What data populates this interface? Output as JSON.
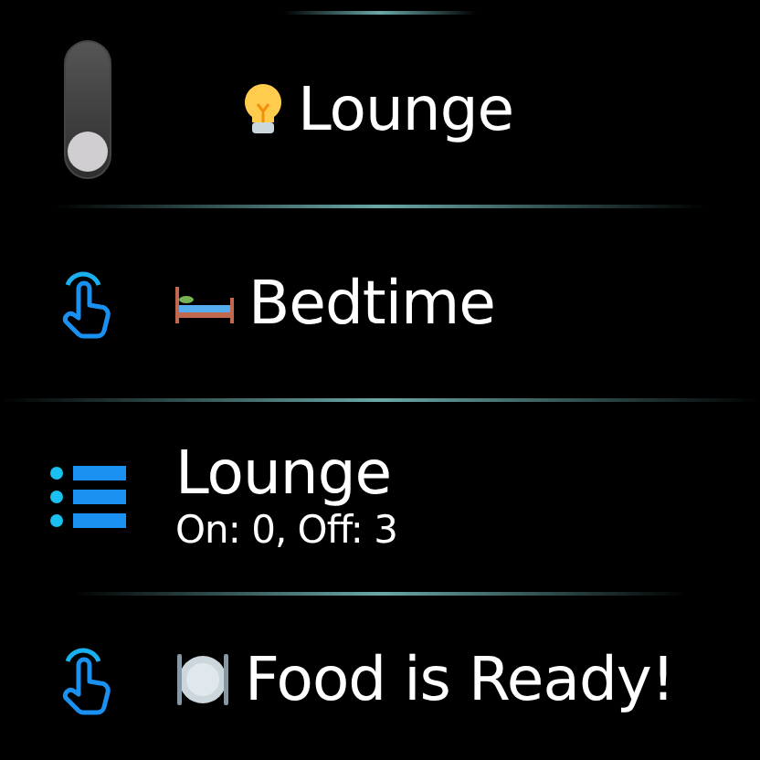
{
  "items": [
    {
      "kind": "toggle",
      "label": "Lounge",
      "on": false
    },
    {
      "kind": "scene",
      "label": "Bedtime"
    },
    {
      "kind": "group",
      "label": "Lounge",
      "subtitle": "On: 0, Off: 3"
    },
    {
      "kind": "scene",
      "label": "Food is Ready!"
    }
  ]
}
